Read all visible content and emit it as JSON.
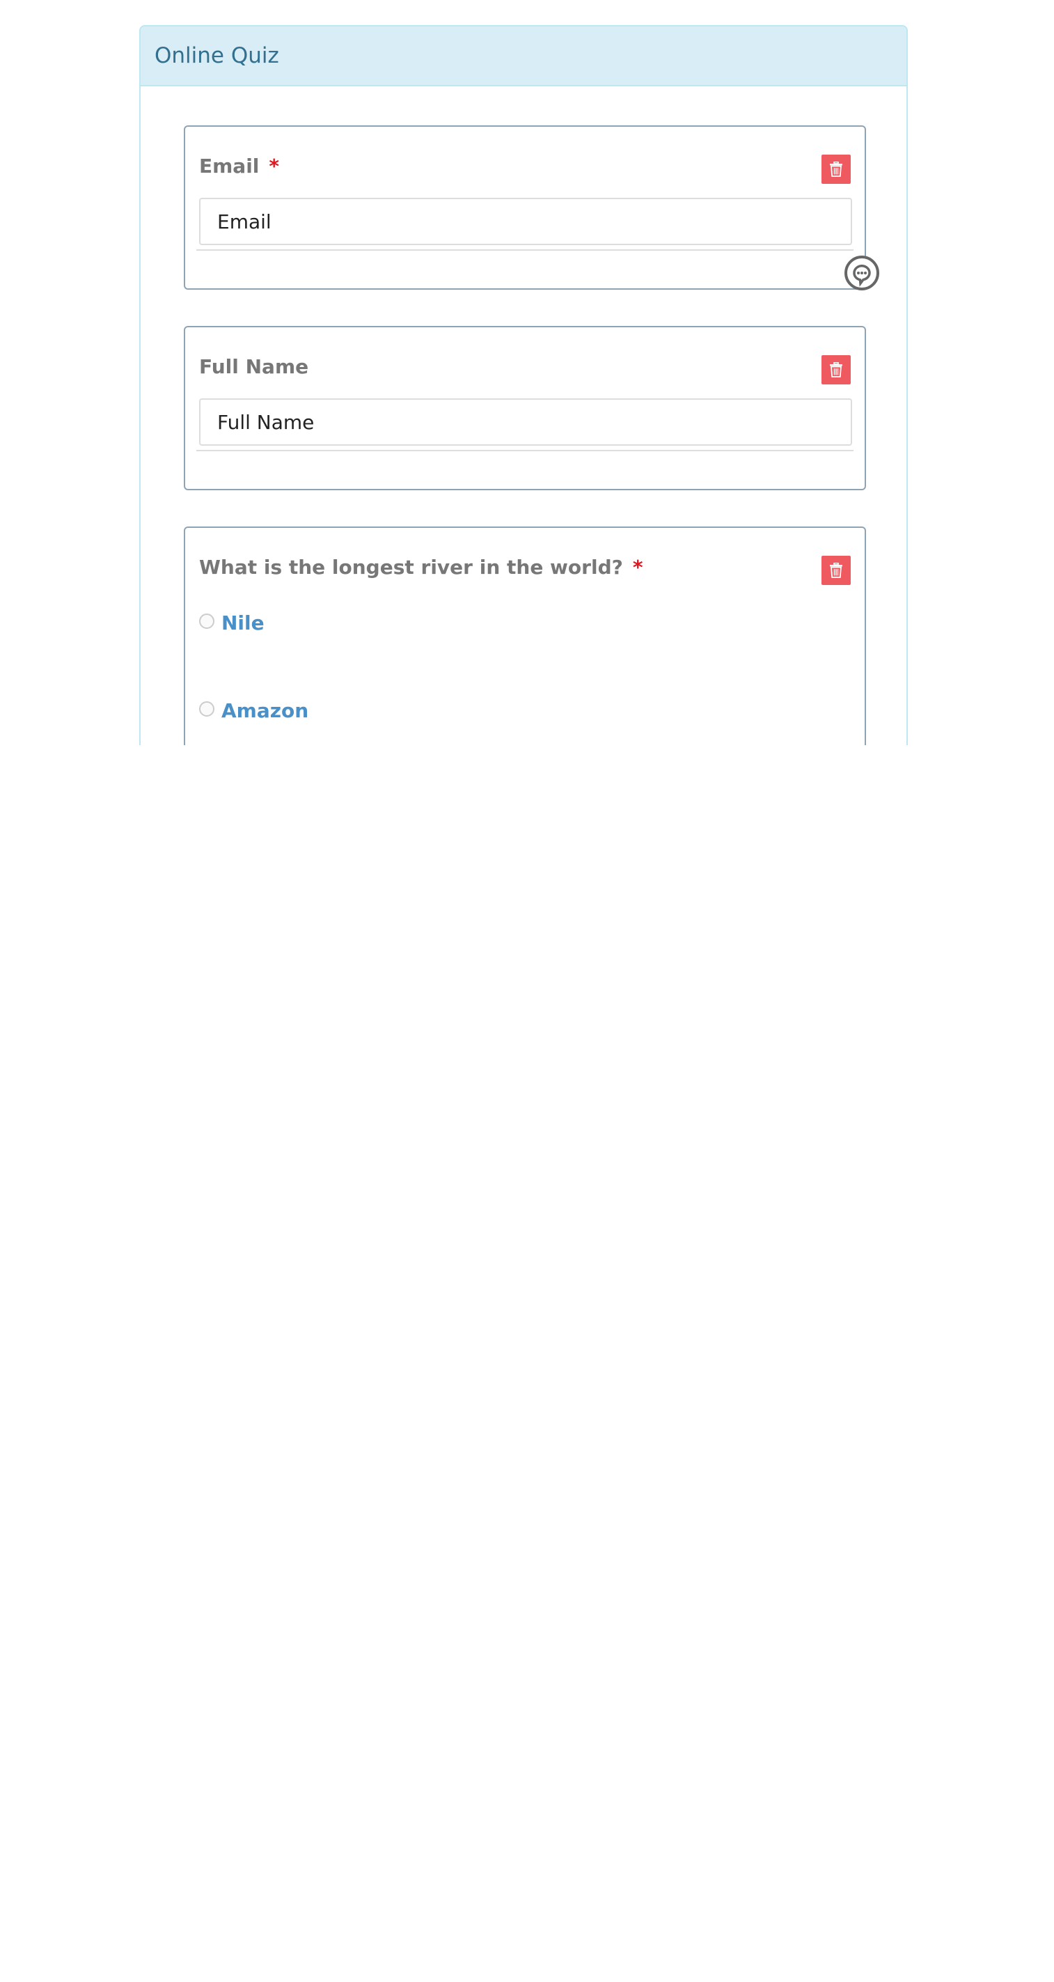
{
  "panel": {
    "title": "Online Quiz"
  },
  "fields": [
    {
      "label": "Email",
      "required_mark": "*",
      "input_value": "Email"
    },
    {
      "label": "Full Name",
      "input_value": "Full Name"
    },
    {
      "label": "What is the longest river in the world?",
      "required_mark": "*",
      "options": [
        "Nile",
        "Amazon"
      ]
    }
  ],
  "icons": {
    "delete": "trash-icon",
    "chat": "chat-bubble-icon"
  },
  "colors": {
    "heading_bg": "#d9edf7",
    "heading_text": "#31708f",
    "delete_button": "#ee5a60",
    "required": "#e3161f",
    "option_text": "#4a90c8"
  }
}
